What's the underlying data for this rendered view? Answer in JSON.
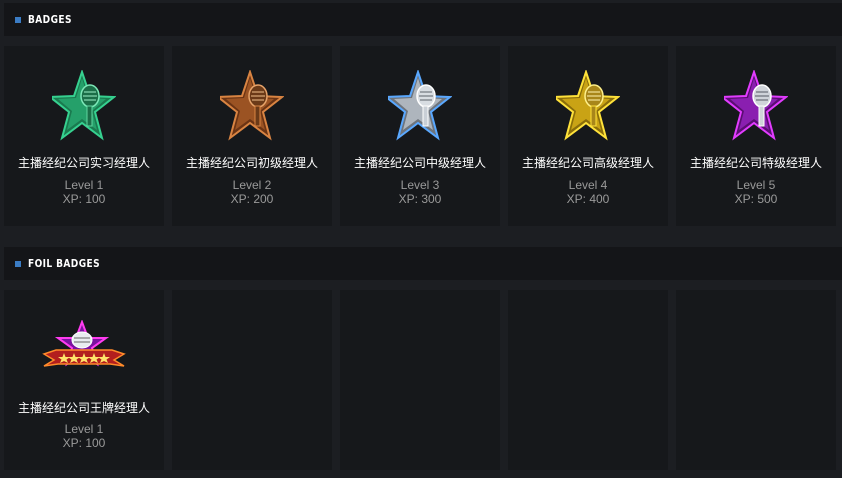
{
  "badges_section": {
    "title": "BADGES",
    "items": [
      {
        "name": "主播经纪公司实习经理人",
        "level": "Level 1",
        "xp": "XP: 100",
        "icon": "microphone-star-icon",
        "color": "#2fb377"
      },
      {
        "name": "主播经纪公司初级经理人",
        "level": "Level 2",
        "xp": "XP: 200",
        "icon": "microphone-star-icon",
        "color": "#b8642a"
      },
      {
        "name": "主播经纪公司中级经理人",
        "level": "Level 3",
        "xp": "XP: 300",
        "icon": "microphone-star-icon",
        "color": "#c9cfd6"
      },
      {
        "name": "主播经纪公司高级经理人",
        "level": "Level 4",
        "xp": "XP: 400",
        "icon": "microphone-star-icon",
        "color": "#d6b21c"
      },
      {
        "name": "主播经纪公司特级经理人",
        "level": "Level 5",
        "xp": "XP: 500",
        "icon": "microphone-star-icon",
        "color": "#b61fd9"
      }
    ]
  },
  "foil_section": {
    "title": "FOIL BADGES",
    "items": [
      {
        "name": "主播经纪公司王牌经理人",
        "level": "Level 1",
        "xp": "XP: 100",
        "icon": "foil-microphone-banner-icon",
        "color": "#d62fd8"
      }
    ]
  }
}
